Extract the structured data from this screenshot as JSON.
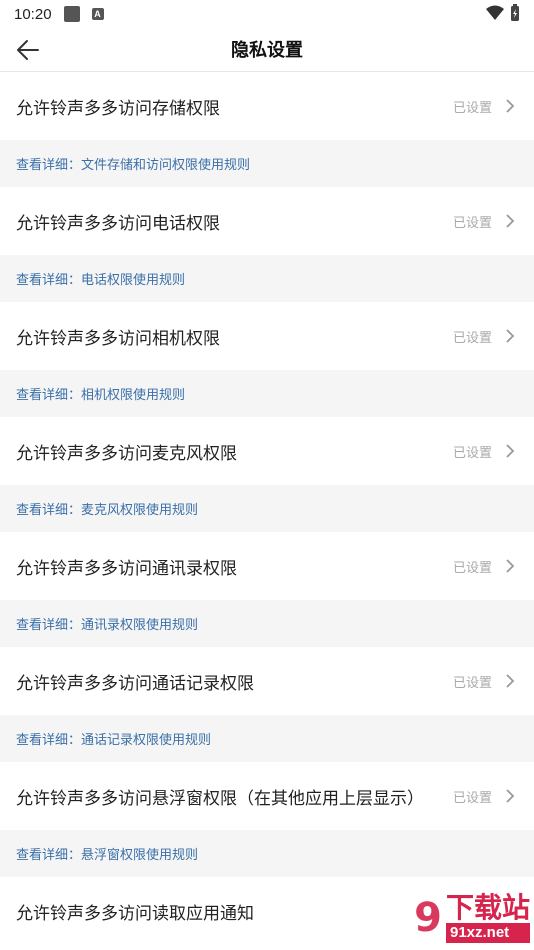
{
  "status_bar": {
    "time": "10:20",
    "a_badge": "A"
  },
  "header": {
    "title": "隐私设置",
    "back_icon": "arrow-left-icon"
  },
  "items": [
    {
      "label": "允许铃声多多访问存储权限",
      "status": "已设置",
      "detail": "查看详细：文件存储和访问权限使用规则"
    },
    {
      "label": "允许铃声多多访问电话权限",
      "status": "已设置",
      "detail": "查看详细：电话权限使用规则"
    },
    {
      "label": "允许铃声多多访问相机权限",
      "status": "已设置",
      "detail": "查看详细：相机权限使用规则"
    },
    {
      "label": "允许铃声多多访问麦克风权限",
      "status": "已设置",
      "detail": "查看详细：麦克风权限使用规则"
    },
    {
      "label": "允许铃声多多访问通讯录权限",
      "status": "已设置",
      "detail": "查看详细：通讯录权限使用规则"
    },
    {
      "label": "允许铃声多多访问通话记录权限",
      "status": "已设置",
      "detail": "查看详细：通话记录权限使用规则"
    },
    {
      "label": "允许铃声多多访问悬浮窗权限（在其他应用上层显示）",
      "status": "已设置",
      "detail": "查看详细：悬浮窗权限使用规则"
    },
    {
      "label": "允许铃声多多访问读取应用通知",
      "status": "",
      "detail": ""
    }
  ],
  "watermark": {
    "logo": "9",
    "main": "下载站",
    "sub": "91xz.net"
  },
  "colors": {
    "link": "#3a6fa8",
    "status": "#aaaaaa",
    "detail_bg": "#f5f5f5",
    "watermark": "#d6244d"
  }
}
